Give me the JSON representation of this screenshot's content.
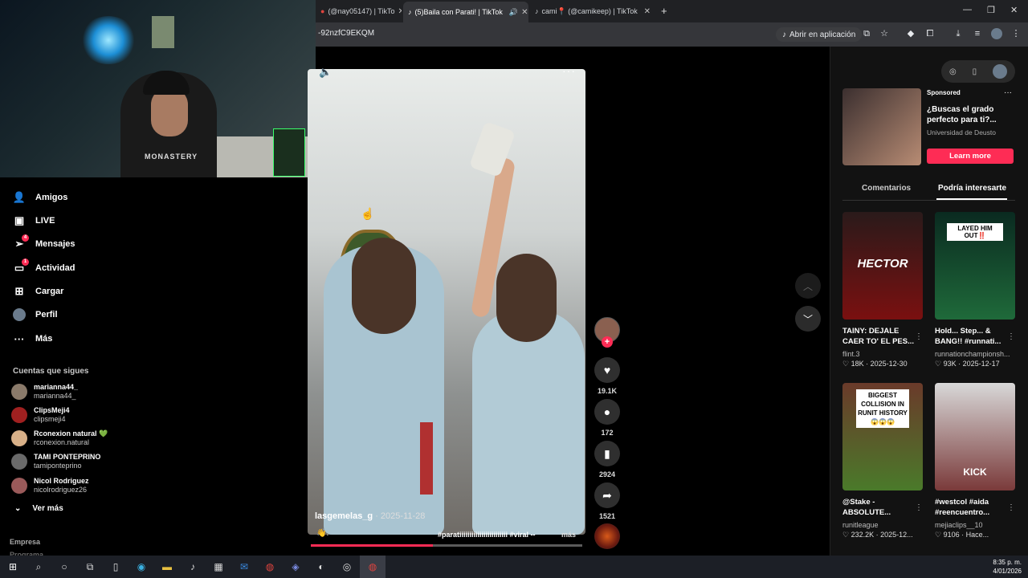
{
  "browser": {
    "tabs": [
      {
        "label": "(@nay05147) | TikTo"
      },
      {
        "label": "(5)Baila con Parati! | TikTok"
      },
      {
        "label": "cami📍 (@camikeep) | TikTok"
      }
    ],
    "url": "-92nzfC9EKQM",
    "open_app_label": "Abrir en aplicación"
  },
  "webcam": {
    "shirt_text": "MONASTERY"
  },
  "nav": {
    "items": [
      {
        "label": "Amigos",
        "icon": "friends-icon"
      },
      {
        "label": "LIVE",
        "icon": "live-icon"
      },
      {
        "label": "Mensajes",
        "icon": "messages-icon",
        "badge": "4"
      },
      {
        "label": "Actividad",
        "icon": "activity-icon",
        "badge": "1"
      },
      {
        "label": "Cargar",
        "icon": "upload-icon"
      },
      {
        "label": "Perfil",
        "icon": "profile-icon"
      },
      {
        "label": "Más",
        "icon": "more-icon"
      }
    ],
    "following_title": "Cuentas que sigues",
    "accounts": [
      {
        "name": "marianna44_",
        "handle": "marianna44_",
        "color": "#8a7a6a"
      },
      {
        "name": "ClipsMeji4",
        "handle": "clipsmeji4",
        "color": "#a02020"
      },
      {
        "name": "Rconexion natural 💚",
        "handle": "rconexion.natural",
        "color": "#d8b088"
      },
      {
        "name": "TAMI PONTEPRINO",
        "handle": "tamiponteprino",
        "color": "#6a6a6a"
      },
      {
        "name": "Nicol Rodriguez",
        "handle": "nicolrodriguez26",
        "color": "#9a5a5a"
      }
    ],
    "see_more": "Ver más",
    "footer": "Empresa",
    "footer2": "Programa"
  },
  "video": {
    "author": "lasgemelas_g",
    "date": " · 2025-11-28",
    "tags": "#paratiiiiiiiiiiiiiiiiiiiiiiii #viral --",
    "more": "más",
    "progress": 0.45
  },
  "actions": {
    "likes": "19.1K",
    "comments": "172",
    "saves": "2924",
    "shares": "1521"
  },
  "ad": {
    "sponsored": "Sponsored",
    "title": "¿Buscas el grado perfecto para ti?...",
    "source": "Universidad de Deusto",
    "cta": "Learn more"
  },
  "panel_tabs": {
    "comments": "Comentarios",
    "interest": "Podría interesarte"
  },
  "recs": [
    {
      "overlay": "HECTOR",
      "title": "TAINY: DEJALE CAER TO' EL PES...",
      "author": "flint.3",
      "stats": "♡ 18K · 2025-12-30",
      "bg": "#3a1010"
    },
    {
      "overlay": "LAYED HIM OUT‼️",
      "title": "Hold... Step... & BANG!! #runnati...",
      "author": "runnationchampionsh...",
      "stats": "♡ 93K · 2025-12-17",
      "bg": "#0f3a2a"
    },
    {
      "overlay": "BIGGEST COLLISION IN RUNIT HISTORY 😱😱😱",
      "title": "@Stake - ABSOLUTE...",
      "author": "runitleague",
      "stats": "♡ 232.2K · 2025-12...",
      "bg": "#3a5a2a"
    },
    {
      "overlay": "KICK",
      "title": "#westcol #aida #reencuentro...",
      "author": "mejiaclips__10",
      "stats": "♡ 9106 · Hace...",
      "bg": "#5a3a3a"
    }
  ],
  "taskbar": {
    "time": "8:35 p. m.",
    "date": "4/01/2026"
  }
}
